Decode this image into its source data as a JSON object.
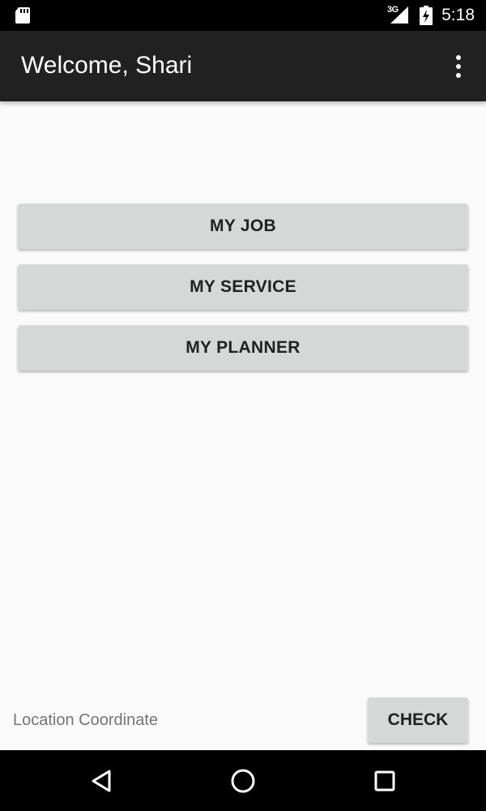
{
  "status_bar": {
    "network_type": "3G",
    "time": "5:18",
    "icons": [
      "sd-card-icon",
      "signal-icon",
      "battery-charging-icon"
    ]
  },
  "app_bar": {
    "title": "Welcome, Shari",
    "menu_icon": "overflow-menu-icon"
  },
  "main": {
    "buttons": [
      {
        "label": "MY JOB"
      },
      {
        "label": "MY SERVICE"
      },
      {
        "label": "MY PLANNER"
      }
    ],
    "location_label": "Location Coordinate",
    "check_label": "CHECK"
  },
  "nav_bar": {
    "icons": [
      "back-icon",
      "home-icon",
      "recents-icon"
    ]
  },
  "colors": {
    "status_bar": "#000000",
    "app_bar": "#212121",
    "background": "#fafafa",
    "button": "#d6d7d7",
    "button_text": "#212121",
    "secondary_text": "#757575"
  }
}
